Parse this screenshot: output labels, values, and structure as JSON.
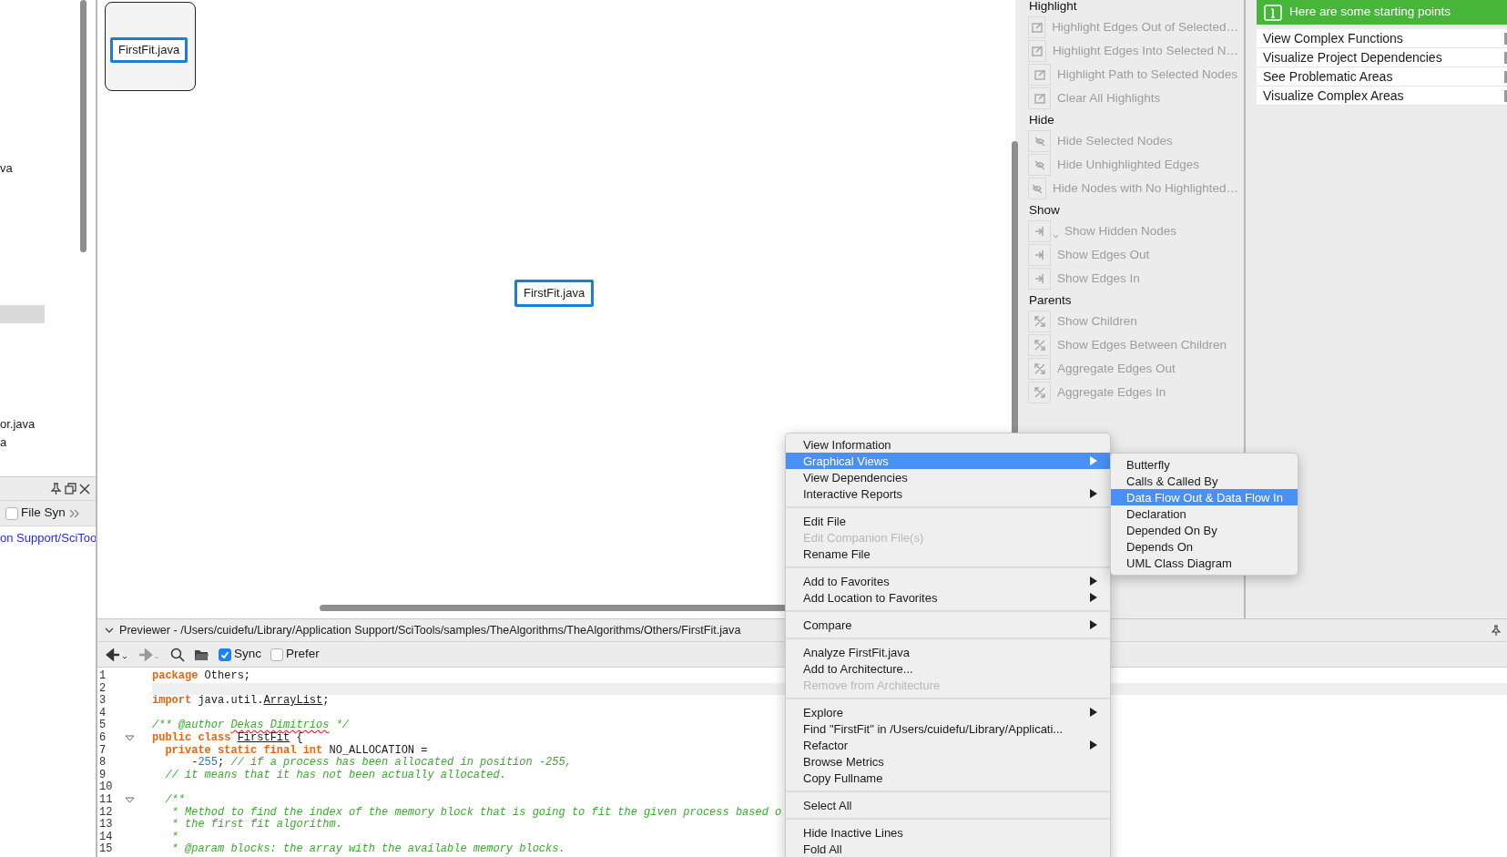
{
  "tree": {
    "rows": [
      {
        "label": "va",
        "selected": false
      },
      {
        "label": "or.java",
        "selected": false
      },
      {
        "label": "a",
        "selected": false
      }
    ]
  },
  "side_panel": {
    "filter": {
      "label": "File Syn",
      "checked": false
    },
    "path_link": "on Support/SciToo"
  },
  "canvas": {
    "group_node": {
      "label": "FirstFit.java"
    },
    "node": {
      "label": "FirstFit.java",
      "selected": true
    }
  },
  "toolbox": {
    "sections": [
      {
        "title": "Highlight",
        "items": [
          {
            "label": "Highlight Edges Out of Selected…",
            "kind": "button",
            "disabled": true
          },
          {
            "label": "Highlight Edges Into Selected N…",
            "kind": "button",
            "disabled": true
          },
          {
            "label": "Highlight Path to Selected Nodes",
            "kind": "button",
            "disabled": true
          },
          {
            "label": "Clear All Highlights",
            "kind": "button",
            "disabled": true
          }
        ]
      },
      {
        "title": "Hide",
        "items": [
          {
            "label": "Hide Selected Nodes",
            "kind": "button",
            "disabled": true
          },
          {
            "label": "Hide Unhighlighted Edges",
            "kind": "button",
            "disabled": true
          },
          {
            "label": "Hide Nodes with No Highlighted…",
            "kind": "button",
            "disabled": true
          }
        ]
      },
      {
        "title": "Show",
        "items": [
          {
            "label": "Show Hidden Nodes",
            "kind": "dropdown",
            "disabled": true
          },
          {
            "label": "Show Edges Out",
            "kind": "button",
            "disabled": true
          },
          {
            "label": "Show Edges In",
            "kind": "button",
            "disabled": true
          }
        ]
      },
      {
        "title": "Parents",
        "items": [
          {
            "label": "Show Children",
            "kind": "button",
            "disabled": true
          },
          {
            "label": "Show Edges Between Children",
            "kind": "button",
            "disabled": true
          },
          {
            "label": "Aggregate Edges Out",
            "kind": "button",
            "disabled": true
          },
          {
            "label": "Aggregate Edges In",
            "kind": "button",
            "disabled": true
          }
        ]
      }
    ]
  },
  "getting_started": {
    "banner": "Here are some starting points",
    "items": [
      "View Complex Functions",
      "Visualize Project Dependencies",
      "See Problematic Areas",
      "Visualize Complex Areas"
    ]
  },
  "previewer": {
    "title": "Previewer - /Users/cuidefu/Library/Application Support/SciTools/samples/TheAlgorithms/TheAlgorithms/Others/FirstFit.java",
    "sync": {
      "label": "Sync",
      "checked": true
    },
    "prefer": {
      "label": "Prefer",
      "checked": false
    },
    "lines": [
      {
        "number": "1",
        "foldable": false,
        "current": false,
        "tokens": [
          {
            "kind": "kw",
            "t": "package"
          },
          {
            "kind": "plain",
            "t": " Others;"
          }
        ]
      },
      {
        "number": "2",
        "foldable": false,
        "current": true
      },
      {
        "number": "3",
        "foldable": false,
        "current": false,
        "tokens": [
          {
            "kind": "kw",
            "t": "import"
          },
          {
            "kind": "plain",
            "t": " java.util."
          },
          {
            "kind": "ref",
            "t": "ArrayList"
          },
          {
            "kind": "plain",
            "t": ";"
          }
        ]
      },
      {
        "number": "4",
        "foldable": false,
        "current": false
      },
      {
        "number": "5",
        "foldable": false,
        "current": false,
        "tokens": [
          {
            "kind": "comment",
            "t": "/** @author "
          },
          {
            "kind": "spell",
            "t": "Dekas Dimitrios"
          },
          {
            "kind": "comment",
            "t": " */"
          }
        ]
      },
      {
        "number": "6",
        "foldable": true,
        "current": false,
        "tokens": [
          {
            "kind": "kw",
            "t": "public class "
          },
          {
            "kind": "ref",
            "t": "FirstFit"
          },
          {
            "kind": "plain",
            "t": " {"
          }
        ]
      },
      {
        "number": "7",
        "foldable": false,
        "current": false,
        "tokens": [
          {
            "kind": "kw",
            "t": "  private static final int"
          },
          {
            "kind": "plain",
            "t": " NO_ALLOCATION ="
          }
        ]
      },
      {
        "number": "8",
        "foldable": false,
        "current": false,
        "tokens": [
          {
            "kind": "plain",
            "t": "      -"
          },
          {
            "kind": "num",
            "t": "255"
          },
          {
            "kind": "plain",
            "t": "; "
          },
          {
            "kind": "comment",
            "t": "// if a process has been allocated in position -255,"
          }
        ]
      },
      {
        "number": "9",
        "foldable": false,
        "current": false,
        "tokens": [
          {
            "kind": "comment",
            "t": "  // it means that it has not been actually allocated."
          }
        ]
      },
      {
        "number": "10",
        "foldable": false,
        "current": false
      },
      {
        "number": "11",
        "foldable": true,
        "current": false,
        "tokens": [
          {
            "kind": "comment",
            "t": "  /**"
          }
        ]
      },
      {
        "number": "12",
        "foldable": false,
        "current": false,
        "tokens": [
          {
            "kind": "comment",
            "t": "   * Method to find the index of the memory block that is going to fit the given process based o"
          }
        ]
      },
      {
        "number": "13",
        "foldable": false,
        "current": false,
        "tokens": [
          {
            "kind": "comment",
            "t": "   * the first fit algorithm."
          }
        ]
      },
      {
        "number": "14",
        "foldable": false,
        "current": false,
        "tokens": [
          {
            "kind": "comment",
            "t": "   *"
          }
        ]
      },
      {
        "number": "15",
        "foldable": false,
        "current": false,
        "tokens": [
          {
            "kind": "comment",
            "t": "   * @param blocks: the array with the available memory blocks."
          }
        ]
      }
    ]
  },
  "context_menu": {
    "groups": [
      [
        {
          "label": "View Information",
          "submenu": false,
          "selected": false,
          "disabled": false
        },
        {
          "label": "Graphical Views",
          "submenu": true,
          "selected": true,
          "disabled": false
        },
        {
          "label": "View Dependencies",
          "submenu": false,
          "selected": false,
          "disabled": false
        },
        {
          "label": "Interactive Reports",
          "submenu": true,
          "selected": false,
          "disabled": false
        }
      ],
      [
        {
          "label": "Edit File",
          "submenu": false,
          "selected": false,
          "disabled": false
        },
        {
          "label": "Edit Companion File(s)",
          "submenu": false,
          "selected": false,
          "disabled": true
        },
        {
          "label": "Rename File",
          "submenu": false,
          "selected": false,
          "disabled": false
        }
      ],
      [
        {
          "label": "Add to Favorites",
          "submenu": true,
          "selected": false,
          "disabled": false
        },
        {
          "label": "Add Location to Favorites",
          "submenu": true,
          "selected": false,
          "disabled": false
        }
      ],
      [
        {
          "label": "Compare",
          "submenu": true,
          "selected": false,
          "disabled": false
        }
      ],
      [
        {
          "label": "Analyze FirstFit.java",
          "submenu": false,
          "selected": false,
          "disabled": false
        },
        {
          "label": "Add to Architecture...",
          "submenu": false,
          "selected": false,
          "disabled": false
        },
        {
          "label": "Remove from Architecture",
          "submenu": false,
          "selected": false,
          "disabled": true
        }
      ],
      [
        {
          "label": "Explore",
          "submenu": true,
          "selected": false,
          "disabled": false
        },
        {
          "label": "Find \"FirstFit\" in /Users/cuidefu/Library/Applicati...",
          "submenu": false,
          "selected": false,
          "disabled": false
        },
        {
          "label": "Refactor",
          "submenu": true,
          "selected": false,
          "disabled": false
        },
        {
          "label": "Browse Metrics",
          "submenu": false,
          "selected": false,
          "disabled": false
        },
        {
          "label": "Copy Fullname",
          "submenu": false,
          "selected": false,
          "disabled": false
        }
      ],
      [
        {
          "label": "Select All",
          "submenu": false,
          "selected": false,
          "disabled": false
        }
      ],
      [
        {
          "label": "Hide Inactive Lines",
          "submenu": false,
          "selected": false,
          "disabled": false
        },
        {
          "label": "Fold All",
          "submenu": false,
          "selected": false,
          "disabled": false
        }
      ]
    ]
  },
  "submenu": {
    "items": [
      {
        "label": "Butterfly",
        "selected": false
      },
      {
        "label": "Calls & Called By",
        "selected": false
      },
      {
        "label": "Data Flow Out & Data Flow In",
        "selected": true
      },
      {
        "label": "Declaration",
        "selected": false
      },
      {
        "label": "Depended On By",
        "selected": false
      },
      {
        "label": "Depends On",
        "selected": false
      },
      {
        "label": "UML Class Diagram",
        "selected": false
      }
    ]
  }
}
